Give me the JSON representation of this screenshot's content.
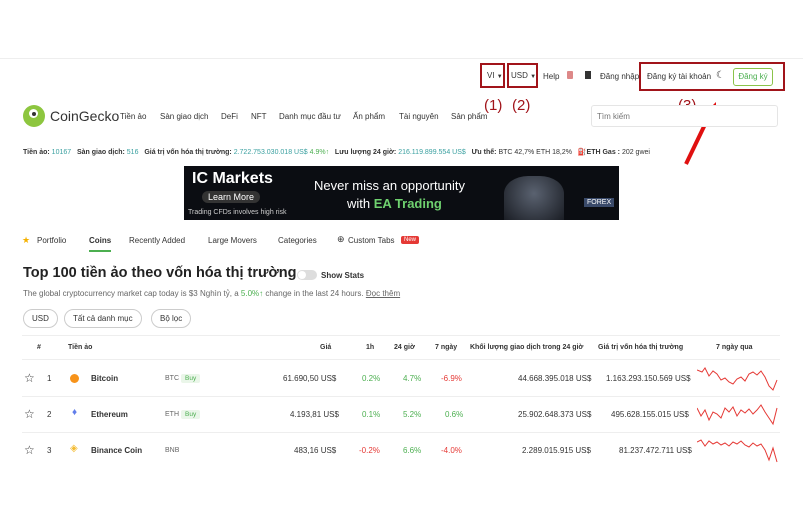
{
  "topbar": {
    "lang": "VI",
    "currency": "USD",
    "help": "Help",
    "login": "Đăng nhập",
    "register_account": "Đăng ký tài khoản",
    "signup_button": "Đăng ký"
  },
  "annotations": {
    "a1": "(1)",
    "a2": "(2)",
    "a3": "(3)"
  },
  "brand": {
    "name": "CoinGecko"
  },
  "nav": [
    "Tiền ảo",
    "Sàn giao dịch",
    "DeFi",
    "NFT",
    "Danh mục đầu tư",
    "Ấn phẩm",
    "Tài nguyên",
    "Sản phẩm"
  ],
  "search": {
    "placeholder": "Tìm kiếm"
  },
  "stats": {
    "coins_label": "Tiền ảo:",
    "coins_value": "10167",
    "exchanges_label": "Sàn giao dịch:",
    "exchanges_value": "516",
    "mcap_label": "Giá trị vốn hóa thị trường:",
    "mcap_value": "2.722.753.030.018 US$",
    "mcap_change": "4.9%",
    "volume_label": "Lưu lượng 24 giờ:",
    "volume_value": "216.119.899.554 US$",
    "dominance_label": "Ưu thế:",
    "dominance_value": "BTC 42,7%   ETH 18,2%",
    "gas_label": "ETH Gas :",
    "gas_value": "202 gwei"
  },
  "ad": {
    "brand": "IC Markets",
    "learn_more": "Learn More",
    "disclaimer": "Trading CFDs involves high risk",
    "headline1": "Never miss an opportunity",
    "headline2_pre": "with ",
    "headline2_em": "EA Trading",
    "forex": "FOREX"
  },
  "tabs": {
    "portfolio": "Portfolio",
    "coins": "Coins",
    "recently_added": "Recently Added",
    "large_movers": "Large Movers",
    "categories": "Categories",
    "custom_tabs": "Custom Tabs",
    "new_badge": "New"
  },
  "heading": {
    "title": "Top 100 tiền ảo theo vốn hóa thị trường",
    "show_stats": "Show Stats",
    "subtitle_pre": "The global cryptocurrency market cap today is $3 Nghìn tỷ, a ",
    "subtitle_change": "5.0%",
    "subtitle_post": " change in the last 24 hours.",
    "read_more": "Đọc thêm"
  },
  "filters": {
    "usd": "USD",
    "all_categories": "Tất cả danh mục",
    "filter": "Bộ lọc"
  },
  "table": {
    "headers": [
      "#",
      "Tiền ảo",
      "Giá",
      "1h",
      "24 giờ",
      "7 ngày",
      "Khối lượng giao dịch trong 24 giờ",
      "Giá trị vốn hóa thị trường",
      "7 ngày qua"
    ],
    "rows": [
      {
        "rank": "1",
        "name": "Bitcoin",
        "symbol": "BTC",
        "buy": "Buy",
        "price": "61.690,50 US$",
        "h1": "0.2%",
        "h24": "4.7%",
        "d7": "-6.9%",
        "volume": "44.668.395.018 US$",
        "mcap": "1.163.293.150.569 US$",
        "icon_color": "#f7931a"
      },
      {
        "rank": "2",
        "name": "Ethereum",
        "symbol": "ETH",
        "buy": "Buy",
        "price": "4.193,81 US$",
        "h1": "0.1%",
        "h24": "5.2%",
        "d7": "0.6%",
        "volume": "25.902.648.373 US$",
        "mcap": "495.628.155.015 US$",
        "icon_color": "#627eea"
      },
      {
        "rank": "3",
        "name": "Binance Coin",
        "symbol": "BNB",
        "buy": "",
        "price": "483,16 US$",
        "h1": "-0.2%",
        "h24": "6.6%",
        "d7": "-4.0%",
        "volume": "2.289.015.915 US$",
        "mcap": "81.237.472.711 US$",
        "icon_color": "#f3ba2f"
      }
    ]
  },
  "colors": {
    "green": "#4caf50",
    "red": "#e53935",
    "annotation": "#a1141a"
  }
}
